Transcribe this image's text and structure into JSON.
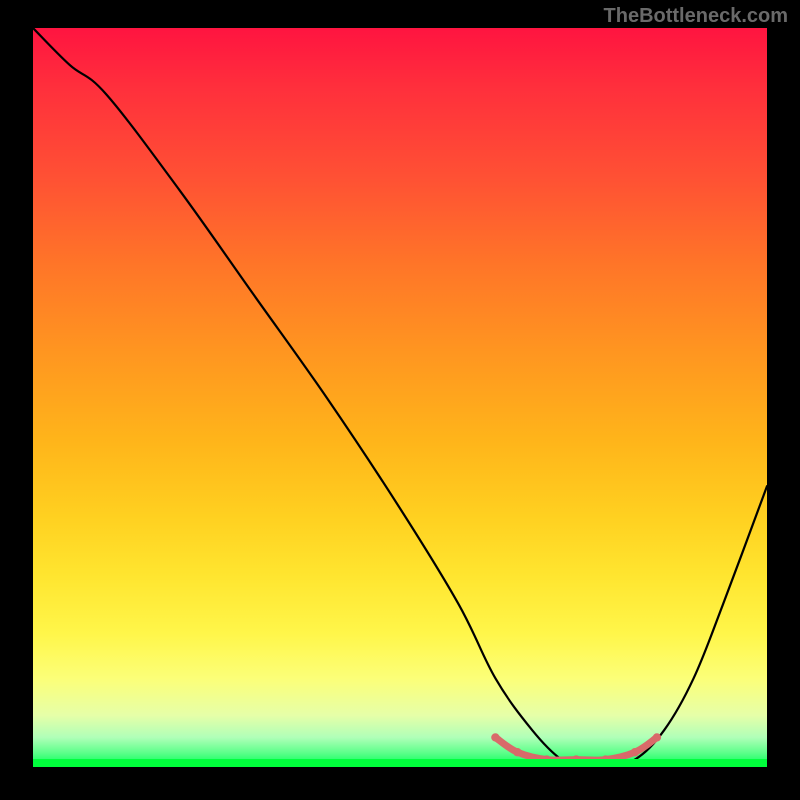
{
  "watermark": "TheBottleneck.com",
  "chart_data": {
    "type": "line",
    "title": "",
    "xlabel": "",
    "ylabel": "",
    "xlim": [
      0,
      100
    ],
    "ylim": [
      0,
      100
    ],
    "series": [
      {
        "name": "bottleneck-curve",
        "x": [
          0,
          5,
          10,
          20,
          30,
          40,
          50,
          58,
          63,
          68,
          72,
          75,
          78,
          82,
          86,
          90,
          94,
          100
        ],
        "y": [
          100,
          95,
          91,
          78,
          64,
          50,
          35,
          22,
          12,
          5,
          1,
          0,
          0,
          1,
          5,
          12,
          22,
          38
        ]
      },
      {
        "name": "optimal-range-marker",
        "x": [
          63,
          66,
          70,
          74,
          78,
          82,
          85
        ],
        "y": [
          4,
          2,
          1,
          1,
          1,
          2,
          4
        ]
      }
    ],
    "annotations": {
      "optimal_min_x": 63,
      "optimal_max_x": 85
    }
  }
}
